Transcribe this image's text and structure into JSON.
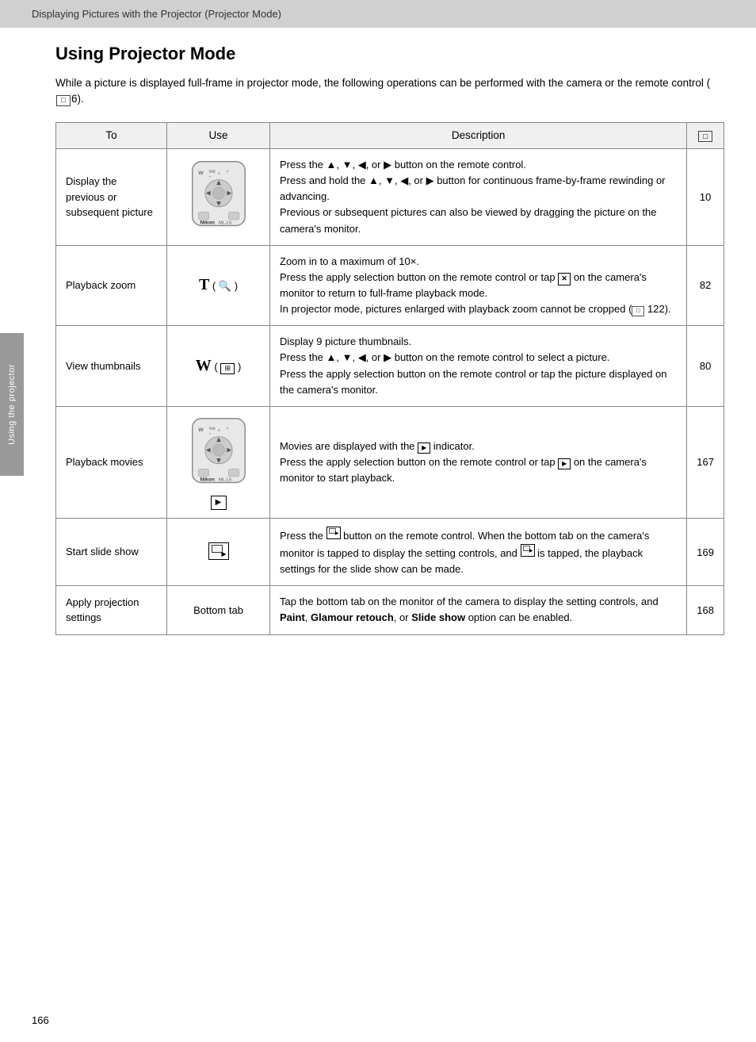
{
  "header": {
    "text": "Displaying Pictures with the Projector (Projector Mode)"
  },
  "page": {
    "title": "Using Projector Mode",
    "intro": "While a picture is displayed full-frame in projector mode, the following operations can be performed with the camera or the remote control (",
    "intro_ref": "6",
    "intro_end": ").",
    "page_number": "166",
    "side_tab": "Using the projector"
  },
  "table": {
    "headers": {
      "to": "To",
      "use": "Use",
      "description": "Description",
      "book": "book"
    },
    "rows": [
      {
        "to": "Display the previous or subsequent picture",
        "use": "remote_image",
        "description_parts": [
          "Press the ▲, ▼, ◀, or ▶ button on the remote control.",
          "Press and hold the ▲, ▼, ◀, or ▶ button for continuous frame-by-frame rewinding or advancing.",
          "Previous or subsequent pictures can also be viewed by dragging the picture on the camera's monitor."
        ],
        "page_ref": "10"
      },
      {
        "to": "Playback zoom",
        "use": "T_symbol",
        "description_parts": [
          "Zoom in to a maximum of 10×.",
          "Press the apply selection button on the remote control or tap",
          "on the camera's monitor to return to full-frame playback mode.",
          "In projector mode, pictures enlarged with playback zoom cannot be cropped (",
          "122)."
        ],
        "page_ref": "82"
      },
      {
        "to": "View thumbnails",
        "use": "W_symbol",
        "description_parts": [
          "Display 9 picture thumbnails.",
          "Press the ▲, ▼, ◀, or ▶ button on the remote control to select a picture.",
          "Press the apply selection button on the remote control or tap the picture displayed on the camera's monitor."
        ],
        "page_ref": "80"
      },
      {
        "to": "Playback movies",
        "use": "remote_and_movie",
        "description_parts": [
          "Movies are displayed with the",
          "indicator.",
          "Press the apply selection button on the remote control or tap",
          "on the camera's monitor to start playback."
        ],
        "page_ref": "167"
      },
      {
        "to": "Start slide show",
        "use": "slideshow_icon",
        "description_parts": [
          "Press the",
          "button on the remote control. When the bottom tab on the camera's monitor is tapped to display the setting controls, and",
          "is tapped, the playback settings for the slide show can be made."
        ],
        "page_ref": "169"
      },
      {
        "to": "Apply projection settings",
        "use": "Bottom tab",
        "description_parts": [
          "Tap the bottom tab on the monitor of the camera to display the setting controls, and",
          "Paint",
          ",",
          "Glamour retouch",
          ", or",
          "Slide show",
          "option can be enabled."
        ],
        "page_ref": "168"
      }
    ]
  }
}
